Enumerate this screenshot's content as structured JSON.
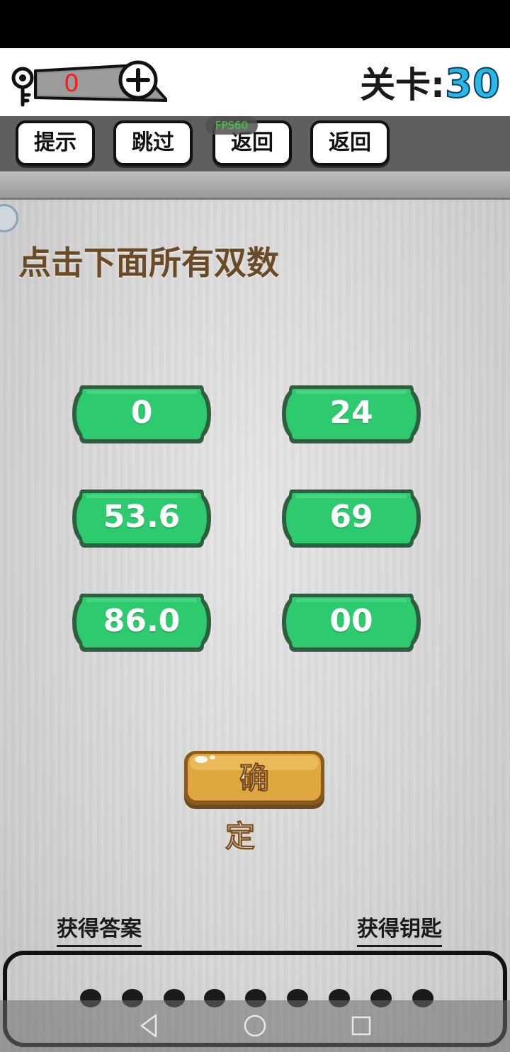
{
  "header": {
    "key_count": "0",
    "level_label": "关卡:",
    "level_number": "30"
  },
  "toolbar": {
    "hint_label": "提示",
    "skip_label": "跳过",
    "back_label_1": "返回",
    "back_label_2": "返回",
    "fps_label": "FPS60"
  },
  "question": {
    "text": "点击下面所有双数"
  },
  "options": [
    {
      "label": "0"
    },
    {
      "label": "24"
    },
    {
      "label": "53.6"
    },
    {
      "label": "69"
    },
    {
      "label": "86.0"
    },
    {
      "label": "00"
    }
  ],
  "confirm": {
    "label": "确定"
  },
  "links": {
    "get_answer": "获得答案",
    "get_key": "获得钥匙"
  },
  "colors": {
    "option_green": "#2ecb6e",
    "option_border": "#2f5e3f",
    "confirm_orange": "#e0a640",
    "level_blue": "#29b6e8",
    "question_brown": "#6b4a26",
    "key_count_red": "#ff1a1a"
  },
  "icons": {
    "key": "key-icon",
    "plus": "plus-icon",
    "nav_back": "triangle-back-icon",
    "nav_home": "circle-home-icon",
    "nav_recent": "square-recent-icon"
  }
}
